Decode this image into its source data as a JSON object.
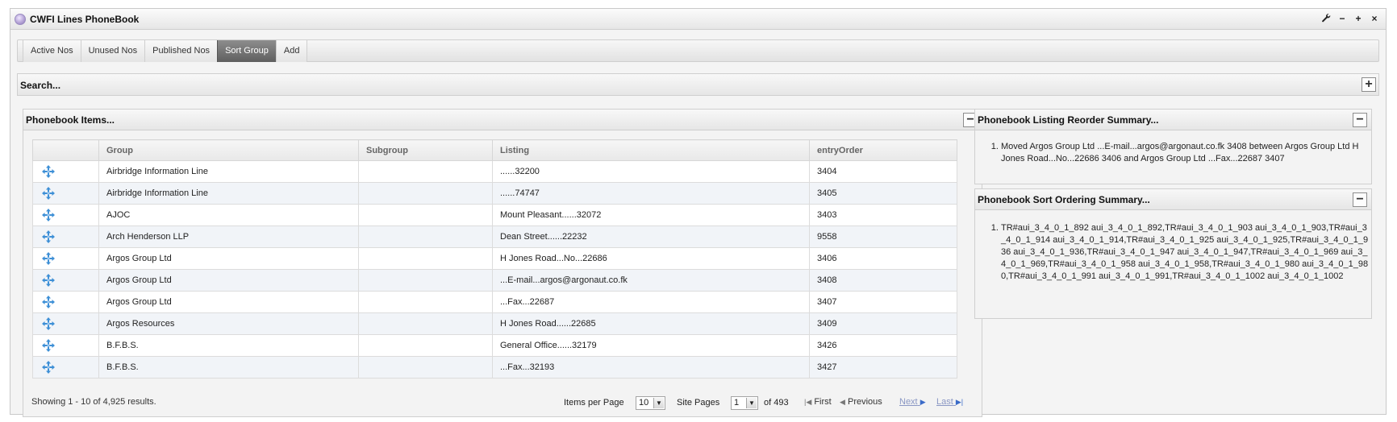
{
  "window": {
    "title": "CWFI Lines PhoneBook"
  },
  "tabs": [
    {
      "label": "Active Nos"
    },
    {
      "label": "Unused Nos"
    },
    {
      "label": "Published Nos"
    },
    {
      "label": "Sort Group"
    },
    {
      "label": "Add"
    }
  ],
  "active_tab": "Sort Group",
  "search": {
    "title": "Search..."
  },
  "items_panel": {
    "title": "Phonebook Items...",
    "columns": [
      "",
      "Group",
      "Subgroup",
      "Listing",
      "entryOrder"
    ],
    "rows": [
      {
        "group": "Airbridge Information Line",
        "subgroup": "",
        "listing": "......32200",
        "order": "3404"
      },
      {
        "group": "Airbridge Information Line",
        "subgroup": "",
        "listing": "......74747",
        "order": "3405"
      },
      {
        "group": "AJOC",
        "subgroup": "",
        "listing": "Mount Pleasant......32072",
        "order": "3403"
      },
      {
        "group": "Arch Henderson LLP",
        "subgroup": "",
        "listing": "Dean Street......22232",
        "order": "9558"
      },
      {
        "group": "Argos Group Ltd",
        "subgroup": "",
        "listing": "H Jones Road...No...22686",
        "order": "3406"
      },
      {
        "group": "Argos Group Ltd",
        "subgroup": "",
        "listing": "...E-mail...argos@argonaut.co.fk",
        "order": "3408"
      },
      {
        "group": "Argos Group Ltd",
        "subgroup": "",
        "listing": "...Fax...22687",
        "order": "3407"
      },
      {
        "group": "Argos Resources",
        "subgroup": "",
        "listing": "H Jones Road......22685",
        "order": "3409"
      },
      {
        "group": "B.F.B.S.",
        "subgroup": "",
        "listing": "General Office......32179",
        "order": "3426"
      },
      {
        "group": "B.F.B.S.",
        "subgroup": "",
        "listing": "...Fax...32193",
        "order": "3427"
      }
    ],
    "pager": {
      "showing": "Showing 1 - 10 of 4,925 results.",
      "items_per_page_label": "Items per Page",
      "items_per_page": "10",
      "site_pages_label": "Site Pages",
      "site_page": "1",
      "of_pages": "of 493",
      "first": "First",
      "previous": "Previous",
      "next": "Next",
      "last": "Last"
    }
  },
  "reorder_panel": {
    "title": "Phonebook Listing Reorder Summary...",
    "items": [
      "Moved Argos Group Ltd ...E-mail...argos@argonaut.co.fk 3408 between Argos Group Ltd H Jones Road...No...22686 3406 and Argos Group Ltd ...Fax...22687 3407"
    ]
  },
  "sort_panel": {
    "title": "Phonebook Sort Ordering Summary...",
    "items": [
      "TR#aui_3_4_0_1_892 aui_3_4_0_1_892,TR#aui_3_4_0_1_903 aui_3_4_0_1_903,TR#aui_3_4_0_1_914 aui_3_4_0_1_914,TR#aui_3_4_0_1_925 aui_3_4_0_1_925,TR#aui_3_4_0_1_936 aui_3_4_0_1_936,TR#aui_3_4_0_1_947 aui_3_4_0_1_947,TR#aui_3_4_0_1_969 aui_3_4_0_1_969,TR#aui_3_4_0_1_958 aui_3_4_0_1_958,TR#aui_3_4_0_1_980 aui_3_4_0_1_980,TR#aui_3_4_0_1_991 aui_3_4_0_1_991,TR#aui_3_4_0_1_1002 aui_3_4_0_1_1002"
    ]
  },
  "colors": {
    "active_tab": "#6f6f6f",
    "move_icon": "#3d8fd6",
    "nav_link": "#3b6bc8"
  },
  "icons": {
    "logo": "app-logo-icon",
    "wrench": "wrench-icon",
    "minimize": "minimize-icon",
    "maximize": "maximize-icon",
    "close": "close-icon",
    "move": "move-icon"
  }
}
